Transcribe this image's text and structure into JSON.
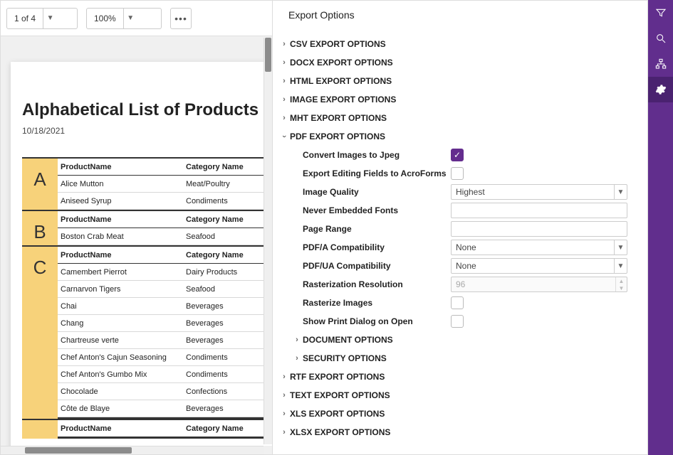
{
  "toolbar": {
    "page_indicator": "1 of 4",
    "zoom": "100%"
  },
  "report": {
    "title": "Alphabetical List of Products",
    "date": "10/18/2021",
    "columns": {
      "name": "ProductName",
      "category": "Category Name"
    },
    "sections": [
      {
        "letter": "A",
        "rows": [
          {
            "name": "Alice Mutton",
            "cat": "Meat/Poultry"
          },
          {
            "name": "Aniseed Syrup",
            "cat": "Condiments"
          }
        ]
      },
      {
        "letter": "B",
        "rows": [
          {
            "name": "Boston Crab Meat",
            "cat": "Seafood"
          }
        ]
      },
      {
        "letter": "C",
        "rows": [
          {
            "name": "Camembert Pierrot",
            "cat": "Dairy Products"
          },
          {
            "name": "Carnarvon Tigers",
            "cat": "Seafood"
          },
          {
            "name": "Chai",
            "cat": "Beverages"
          },
          {
            "name": "Chang",
            "cat": "Beverages"
          },
          {
            "name": "Chartreuse verte",
            "cat": "Beverages"
          },
          {
            "name": "Chef Anton's Cajun Seasoning",
            "cat": "Condiments"
          },
          {
            "name": "Chef Anton's Gumbo Mix",
            "cat": "Condiments"
          },
          {
            "name": "Chocolade",
            "cat": "Confections"
          },
          {
            "name": "Côte de Blaye",
            "cat": "Beverages"
          }
        ]
      }
    ]
  },
  "options": {
    "title": "Export Options",
    "groups": {
      "csv": "CSV EXPORT OPTIONS",
      "docx": "DOCX EXPORT OPTIONS",
      "html": "HTML EXPORT OPTIONS",
      "image": "IMAGE EXPORT OPTIONS",
      "mht": "MHT EXPORT OPTIONS",
      "pdf": "PDF EXPORT OPTIONS",
      "rtf": "RTF EXPORT OPTIONS",
      "text": "TEXT EXPORT OPTIONS",
      "xls": "XLS EXPORT OPTIONS",
      "xlsx": "XLSX EXPORT OPTIONS"
    },
    "pdf": {
      "convert_images_label": "Convert Images to Jpeg",
      "export_editing_label": "Export Editing Fields to AcroForms",
      "image_quality_label": "Image Quality",
      "image_quality_value": "Highest",
      "never_embedded_label": "Never Embedded Fonts",
      "never_embedded_value": "",
      "page_range_label": "Page Range",
      "page_range_value": "",
      "pdfa_label": "PDF/A Compatibility",
      "pdfa_value": "None",
      "pdfua_label": "PDF/UA Compatibility",
      "pdfua_value": "None",
      "raster_res_label": "Rasterization Resolution",
      "raster_res_value": "96",
      "rasterize_label": "Rasterize Images",
      "show_print_label": "Show Print Dialog on Open",
      "doc_options": "DOCUMENT OPTIONS",
      "sec_options": "SECURITY OPTIONS"
    }
  }
}
